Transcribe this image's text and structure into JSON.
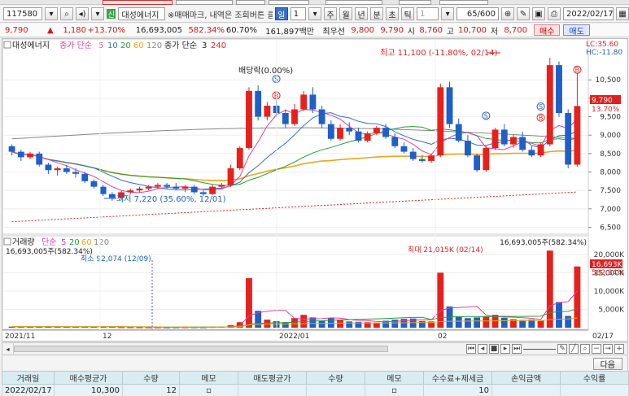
{
  "toolbar": {
    "code": "117580",
    "stock_name": "대성에너지",
    "marker_text": "※매매마크, 내역은 조회버튼 클릭",
    "periods": [
      "일",
      "주",
      "월",
      "년",
      "분",
      "초",
      "틱"
    ],
    "period_num": "1",
    "tick_num": "1",
    "count": "65",
    "count_total": "/600",
    "date": "2022/02/17"
  },
  "info": {
    "price": "9,790",
    "change": "1,180",
    "change_pct": "+13.70%",
    "volume": "16,693,005",
    "vol_ratio": "582.34%",
    "vol_rate": "60.70%",
    "amount": "161,897백만",
    "priority_label": "최우선",
    "ask": "9,800",
    "bid": "9,790",
    "open_label": "시",
    "open": "8,760",
    "high_label": "고",
    "high": "10,700",
    "low_label": "저",
    "low": "8,700",
    "buy_label": "매수",
    "sell_label": "매도"
  },
  "legend": {
    "price": [
      "대성에너지",
      "종가 단순",
      "5",
      "10",
      "20",
      "60",
      "120",
      "종가 단순",
      "3",
      "240"
    ],
    "volume": [
      "거래량",
      "단순",
      "5",
      "20",
      "60",
      "120"
    ]
  },
  "annotations": {
    "lc": "LC:35.60",
    "hc": "HC:-11.80",
    "dividend": "배당락(0.00%)",
    "high_note": "최고 11,100 (-11.80%, 02/14)",
    "low_note": "최저 7,220 (35.60%, 12/01)",
    "vol_left": "16,693,005주(582.34%)",
    "vol_right": "16,693,005주(582.34%)",
    "vol_min": "최소 92,074 (12/09)",
    "vol_max": "최대 21,015K (02/14)",
    "price_tag": "9,790",
    "price_tag_pct": "13.70%",
    "vol_tag": "16,693K",
    "vol_tag_pct": "582.34%"
  },
  "axes": {
    "price_ticks": [
      "10,500",
      "10,000",
      "9,500",
      "9,000",
      "8,500",
      "8,000",
      "7,500",
      "7,000",
      "6,500"
    ],
    "volume_ticks": [
      "20,000K",
      "15,000K",
      "10,000K",
      "5,000K"
    ],
    "x_labels": [
      "2021/11",
      "12",
      "2022/01",
      "02",
      "02/17"
    ]
  },
  "colors": {
    "up": "#e8201c",
    "down": "#1f5fc8",
    "ma5": "#e040a0",
    "ma10": "#3070d0",
    "ma20": "#2a9a3a",
    "ma60": "#e7a817",
    "ma120": "#888888",
    "ma240": "#e02020"
  },
  "chart_data": {
    "type": "candlestick",
    "dates_range": [
      "2021/11",
      "2022/02/17"
    ],
    "candles": [
      [
        8700,
        8750,
        8450,
        8550
      ],
      [
        8550,
        8600,
        8300,
        8400
      ],
      [
        8400,
        8550,
        8350,
        8500
      ],
      [
        8500,
        8550,
        8150,
        8200
      ],
      [
        8200,
        8250,
        7950,
        8050
      ],
      [
        8050,
        8150,
        7900,
        8100
      ],
      [
        8100,
        8200,
        7950,
        8000
      ],
      [
        8000,
        8100,
        7850,
        7950
      ],
      [
        7950,
        8000,
        7700,
        7750
      ],
      [
        7750,
        7800,
        7550,
        7600
      ],
      [
        7600,
        7650,
        7350,
        7400
      ],
      [
        7400,
        7450,
        7220,
        7300
      ],
      [
        7300,
        7500,
        7250,
        7450
      ],
      [
        7450,
        7550,
        7400,
        7500
      ],
      [
        7500,
        7600,
        7450,
        7550
      ],
      [
        7550,
        7650,
        7500,
        7600
      ],
      [
        7600,
        7700,
        7550,
        7650
      ],
      [
        7650,
        7700,
        7550,
        7600
      ],
      [
        7600,
        7700,
        7500,
        7550
      ],
      [
        7550,
        7650,
        7450,
        7600
      ],
      [
        7600,
        7650,
        7400,
        7450
      ],
      [
        7450,
        7500,
        7350,
        7400
      ],
      [
        7400,
        7650,
        7380,
        7600
      ],
      [
        7600,
        7700,
        7550,
        7650
      ],
      [
        7650,
        8200,
        7600,
        8100
      ],
      [
        8100,
        8700,
        8050,
        8650
      ],
      [
        8650,
        10300,
        8600,
        10200
      ],
      [
        10200,
        10350,
        9400,
        9500
      ],
      [
        9500,
        9900,
        9400,
        9800
      ],
      [
        9800,
        9950,
        9500,
        9600
      ],
      [
        9600,
        9700,
        9200,
        9300
      ],
      [
        9300,
        9850,
        9250,
        9700
      ],
      [
        9700,
        10200,
        9650,
        10100
      ],
      [
        10100,
        10300,
        9600,
        9700
      ],
      [
        9700,
        9800,
        9200,
        9300
      ],
      [
        9300,
        9400,
        8850,
        8900
      ],
      [
        8900,
        9300,
        8850,
        9200
      ],
      [
        9200,
        9350,
        9000,
        9100
      ],
      [
        9100,
        9200,
        8800,
        8850
      ],
      [
        8850,
        9100,
        8800,
        9050
      ],
      [
        9050,
        9250,
        9000,
        9200
      ],
      [
        9200,
        9300,
        8900,
        8950
      ],
      [
        8950,
        9050,
        8650,
        8700
      ],
      [
        8700,
        8800,
        8500,
        8550
      ],
      [
        8550,
        8650,
        8300,
        8350
      ],
      [
        8350,
        8450,
        8250,
        8300
      ],
      [
        8300,
        8500,
        8250,
        8450
      ],
      [
        8450,
        10400,
        8400,
        10300
      ],
      [
        10300,
        10450,
        9200,
        9300
      ],
      [
        9300,
        9450,
        8800,
        8850
      ],
      [
        8850,
        9000,
        8400,
        8450
      ],
      [
        8450,
        8500,
        8000,
        8050
      ],
      [
        8050,
        8700,
        8000,
        8650
      ],
      [
        8650,
        9200,
        8600,
        9150
      ],
      [
        9150,
        9300,
        8700,
        8750
      ],
      [
        8750,
        9000,
        8650,
        8950
      ],
      [
        8950,
        9100,
        8550,
        8600
      ],
      [
        8600,
        8700,
        8400,
        8450
      ],
      [
        8450,
        8800,
        8400,
        8750
      ],
      [
        8750,
        11100,
        8700,
        10900
      ],
      [
        10900,
        11000,
        9500,
        9600
      ],
      [
        9600,
        9700,
        8100,
        8200
      ],
      [
        8200,
        10700,
        8150,
        9790
      ]
    ],
    "volumes": [
      300,
      260,
      280,
      240,
      260,
      250,
      230,
      220,
      260,
      300,
      340,
      320,
      150,
      140,
      120,
      110,
      100,
      92,
      110,
      120,
      130,
      120,
      200,
      250,
      700,
      1500,
      13500,
      4600,
      2200,
      1800,
      1500,
      2600,
      3500,
      2800,
      1900,
      2600,
      2200,
      1700,
      1600,
      1500,
      1400,
      1900,
      2200,
      2400,
      2500,
      1800,
      1700,
      15000,
      5800,
      3100,
      2600,
      2800,
      3000,
      3500,
      2700,
      2300,
      2100,
      2200,
      2000,
      21015,
      7000,
      3200,
      16693
    ],
    "ylim": [
      6400,
      11300
    ],
    "vol_ylim": [
      0,
      21500
    ]
  },
  "table": {
    "headers": [
      "거래일",
      "매수평균가",
      "수량",
      "메모",
      "매도평균가",
      "수량",
      "메모",
      "수수료+제세금",
      "손익금액",
      "수익률"
    ],
    "rows": [
      [
        "2022/02/17",
        "10,300",
        "12",
        "",
        "",
        "",
        "",
        "10",
        "",
        ""
      ]
    ]
  },
  "next_label": "다음"
}
